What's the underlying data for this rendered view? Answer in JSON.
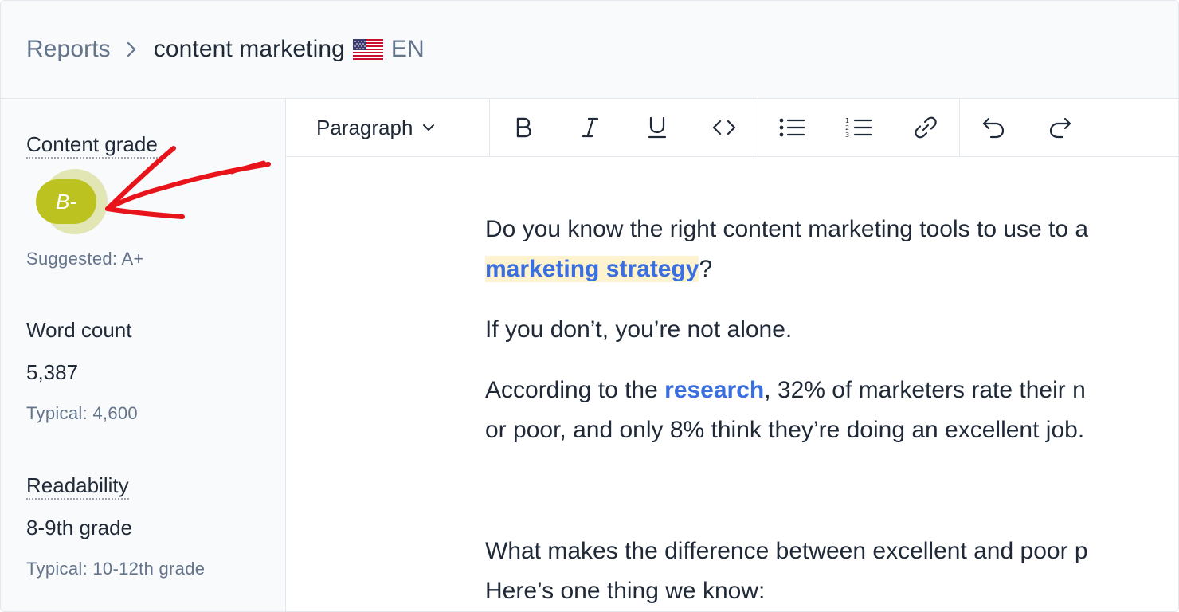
{
  "breadcrumb": {
    "root": "Reports",
    "separator_icon": "chevron-right-icon",
    "current": "content marketing",
    "flag_icon": "us-flag-icon",
    "language": "EN"
  },
  "sidebar": {
    "content_grade": {
      "label": "Content grade",
      "grade": "B-",
      "suggested": "Suggested: A+",
      "badge_color": "#bcc21f"
    },
    "word_count": {
      "label": "Word count",
      "value": "5,387",
      "typical": "Typical: 4,600"
    },
    "readability": {
      "label": "Readability",
      "value": "8-9th grade",
      "typical": "Typical: 10-12th grade"
    }
  },
  "toolbar": {
    "block_type": "Paragraph",
    "buttons": [
      {
        "name": "bold-icon"
      },
      {
        "name": "italic-icon"
      },
      {
        "name": "underline-icon"
      },
      {
        "name": "code-icon"
      },
      {
        "name": "bullet-list-icon"
      },
      {
        "name": "numbered-list-icon"
      },
      {
        "name": "link-icon"
      },
      {
        "name": "undo-icon"
      },
      {
        "name": "redo-icon"
      }
    ]
  },
  "document": {
    "p1_start": "Do you know the right content marketing tools to use to a",
    "p1_link": "marketing strategy",
    "p1_end": "?",
    "p2": "If you don’t, you’re not alone.",
    "p3_start": "According to the ",
    "p3_link": "research",
    "p3_mid": ", 32% of marketers rate their n",
    "p3_line2": "or poor, and only 8% think they’re doing an excellent job.",
    "p4_line1": "What makes the difference between excellent and poor p",
    "p4_line2": "Here’s one thing we know:"
  },
  "colors": {
    "link": "#3b6fe0",
    "highlight": "#fdf3cf",
    "annotation": "#e8141b"
  }
}
